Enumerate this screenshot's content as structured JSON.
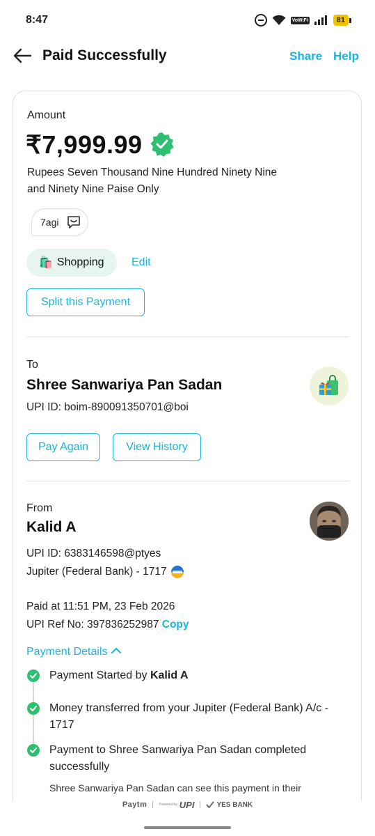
{
  "status_bar": {
    "time": "8:47",
    "vowifi_line1": "Vo",
    "vowifi_line2": "WiFi",
    "battery": "81"
  },
  "header": {
    "title": "Paid Successfully",
    "share": "Share",
    "help": "Help"
  },
  "amount": {
    "label": "Amount",
    "value": "₹7,999.99",
    "words": "Rupees Seven Thousand Nine Hundred Ninety Nine and Ninety Nine Paise Only",
    "note": "7agi",
    "category_emoji": "🛍️",
    "category": "Shopping",
    "edit": "Edit",
    "split_button": "Split this Payment"
  },
  "to": {
    "label": "To",
    "name": "Shree Sanwariya Pan Sadan",
    "upi": "UPI ID: boim-890091350701@boi",
    "pay_again": "Pay Again",
    "view_history": "View History"
  },
  "from": {
    "label": "From",
    "name": "Kalid A",
    "upi": "UPI ID: 6383146598@ptyes",
    "bank": "Jupiter (Federal Bank) - 1717",
    "paid_at": "Paid at 11:51 PM, 23 Feb 2026",
    "ref_label": "UPI Ref No: 397836252987",
    "copy": "Copy"
  },
  "payment_details": {
    "toggle": "Payment Details",
    "steps": [
      {
        "prefix": "Payment Started by ",
        "bold": "Kalid A"
      },
      {
        "text": "Money transferred from your Jupiter (Federal Bank) A/c - 1717"
      },
      {
        "text": "Payment to Shree Sanwariya Pan Sadan completed successfully"
      }
    ],
    "sub_text": "Shree Sanwariya Pan Sadan can see this payment in their"
  },
  "footer": {
    "paytm": "Paytm",
    "powered_by": "Powered by",
    "upi": "UPI",
    "bank": "YES BANK"
  },
  "colors": {
    "accent": "#1ab4e0",
    "success": "#2fbf71",
    "category_bg": "#e6f5ee"
  }
}
